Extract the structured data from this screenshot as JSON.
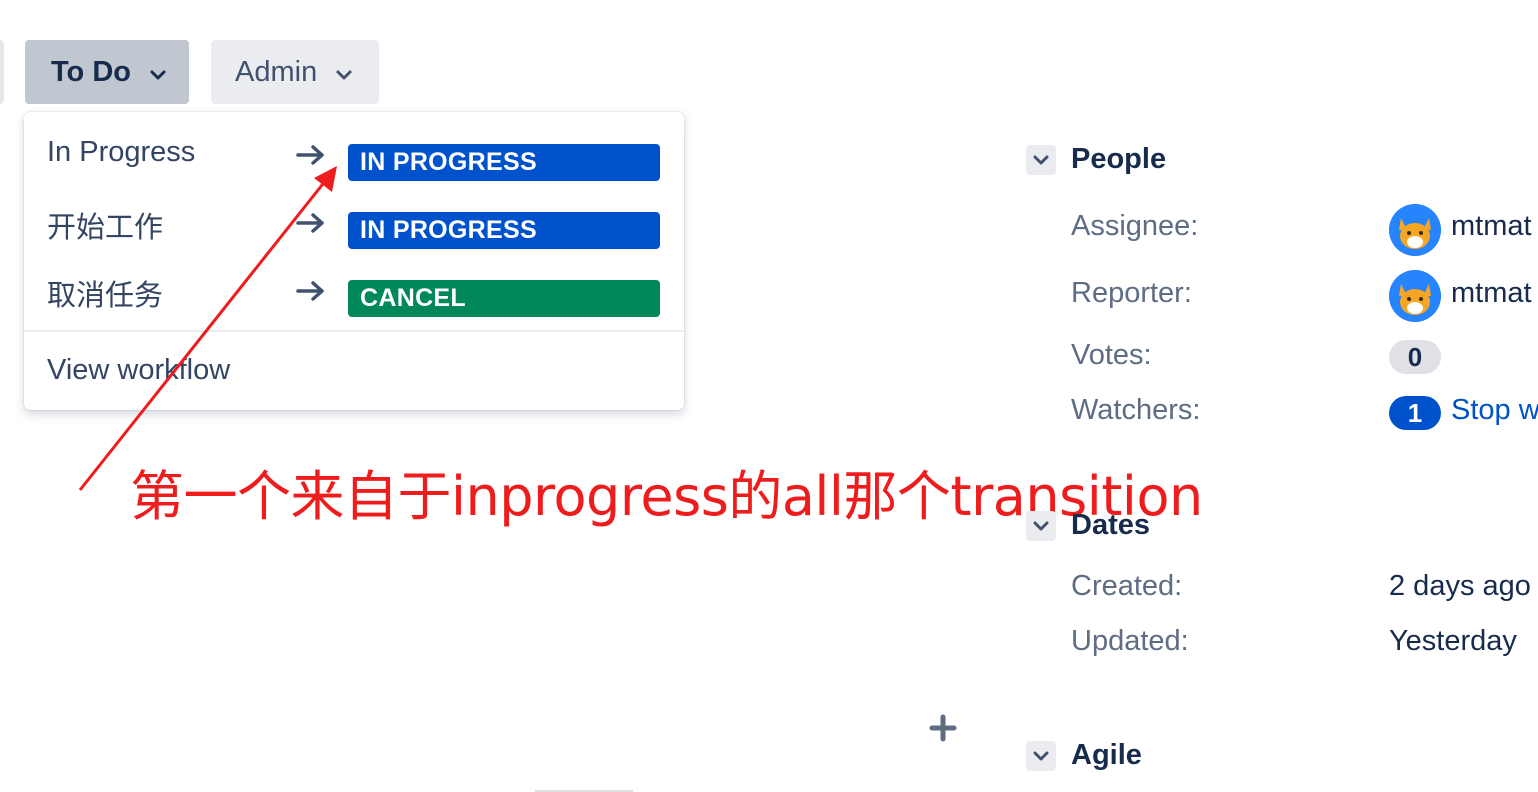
{
  "toolbar": {
    "status_button_label": "To Do",
    "admin_button_label": "Admin"
  },
  "transitions": {
    "items": [
      {
        "label": "In Progress",
        "target_status": "IN PROGRESS",
        "target_color": "#0052cc"
      },
      {
        "label": "开始工作",
        "target_status": "IN PROGRESS",
        "target_color": "#0052cc"
      },
      {
        "label": "取消任务",
        "target_status": "CANCEL",
        "target_color": "#00875a"
      }
    ],
    "view_workflow_label": "View workflow"
  },
  "annotation": {
    "text": "第一个来自于inprogress的all那个transition",
    "color": "#ee1c1c"
  },
  "people": {
    "title": "People",
    "assignee_label": "Assignee:",
    "assignee_name": "mtmat",
    "reporter_label": "Reporter:",
    "reporter_name": "mtmat",
    "votes_label": "Votes:",
    "votes_count": "0",
    "watchers_label": "Watchers:",
    "watchers_count": "1",
    "watch_link": "Stop w"
  },
  "dates": {
    "title": "Dates",
    "created_label": "Created:",
    "created_value": "2 days ago",
    "updated_label": "Updated:",
    "updated_value": "Yesterday"
  },
  "agile": {
    "title": "Agile"
  },
  "colors": {
    "accent": "#0052cc",
    "success": "#00875a",
    "annotation_red": "#ee1c1c"
  }
}
